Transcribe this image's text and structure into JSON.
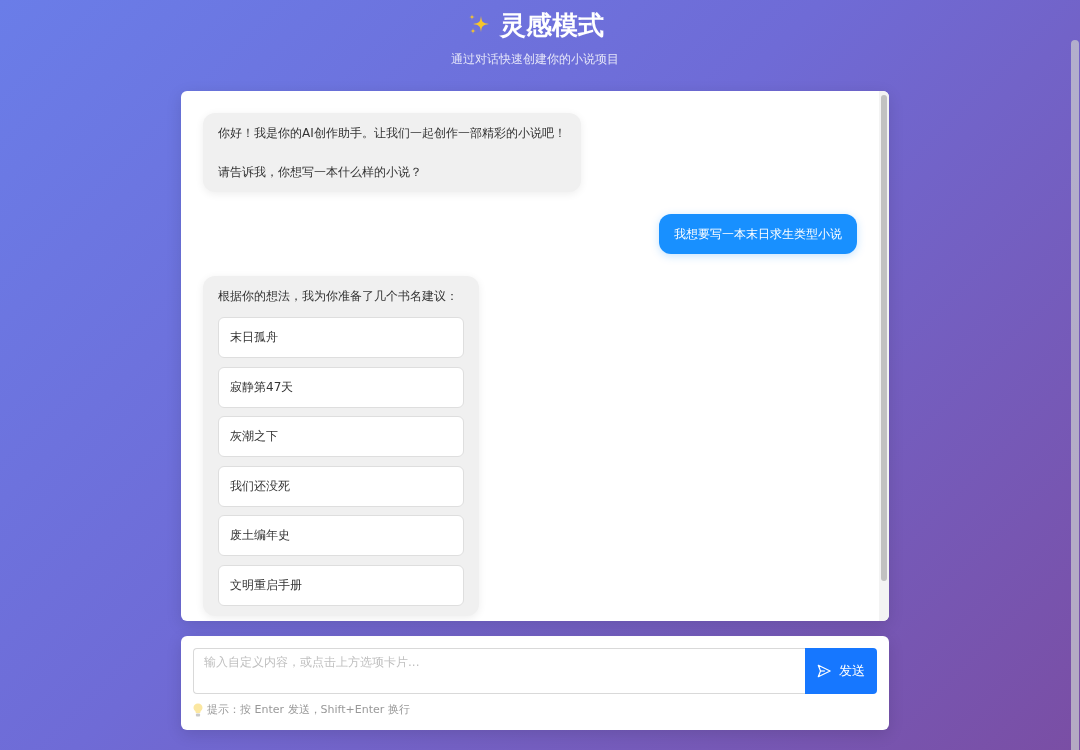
{
  "header": {
    "title": "灵感模式",
    "subtitle": "通过对话快速创建你的小说项目"
  },
  "messages": [
    {
      "kind": "incoming",
      "paragraphs": [
        "你好！我是你的AI创作助手。让我们一起创作一部精彩的小说吧！",
        "请告诉我，你想写一本什么样的小说？"
      ]
    },
    {
      "kind": "outgoing",
      "paragraphs": [
        "我想要写一本末日求生类型小说"
      ]
    },
    {
      "kind": "incoming",
      "paragraphs": [
        "根据你的想法，我为你准备了几个书名建议："
      ],
      "options": [
        "末日孤舟",
        "寂静第47天",
        "灰潮之下",
        "我们还没死",
        "废土编年史",
        "文明重启手册"
      ]
    }
  ],
  "composer": {
    "placeholder": "输入自定义内容，或点击上方选项卡片...",
    "send_label": "发送",
    "hint": "提示：按 Enter 发送，Shift+Enter 换行"
  }
}
